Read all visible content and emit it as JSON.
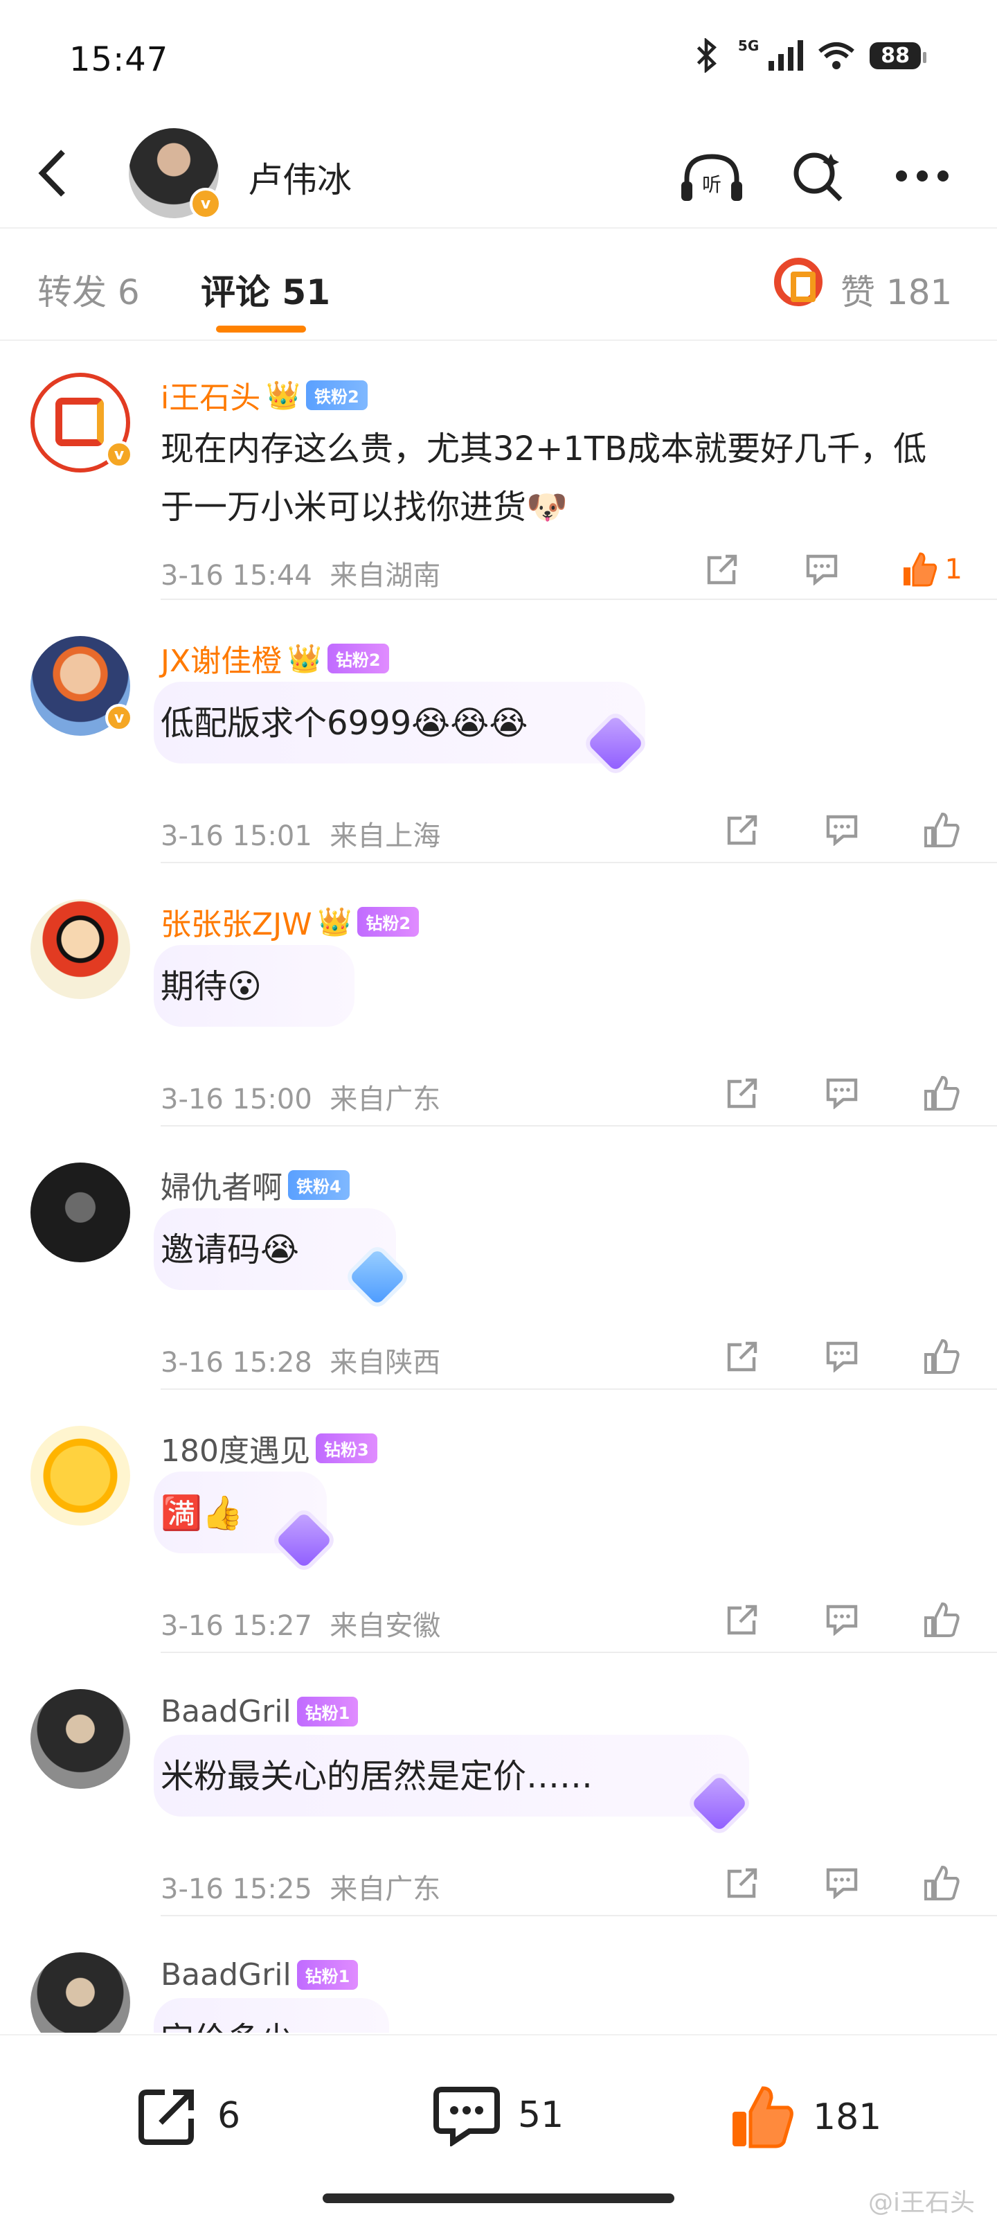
{
  "status_bar": {
    "time": "15:47",
    "network": "5G",
    "battery": "88"
  },
  "header": {
    "user_name": "卢伟冰"
  },
  "tabs": [
    {
      "label": "转发 6"
    },
    {
      "label": "评论 51"
    },
    {
      "label": "赞 181"
    }
  ],
  "comments": [
    {
      "name": "i王石头",
      "badge": "铁粉2",
      "text": "现在内存这么贵，尤其32+1TB成本就要好几千，低于一万小米可以找你进货🐶",
      "time": "3-16 15:44",
      "location": "来自湖南",
      "likes": "1"
    },
    {
      "name": "JX谢佳橙",
      "badge": "钻粉2",
      "text": "低配版求个6999😭😭😭",
      "time": "3-16 15:01",
      "location": "来自上海",
      "likes": ""
    },
    {
      "name": "张张张ZJW",
      "badge": "钻粉2",
      "text": "期待😮",
      "time": "3-16 15:00",
      "location": "来自广东",
      "likes": ""
    },
    {
      "name": "婦仇者啊",
      "badge": "铁粉4",
      "text": "邀请码😭",
      "time": "3-16 15:28",
      "location": "来自陕西",
      "likes": ""
    },
    {
      "name": "180度遇见",
      "badge": "钻粉3",
      "text": "🈵👍",
      "time": "3-16 15:27",
      "location": "来自安徽",
      "likes": ""
    },
    {
      "name": "BaadGril",
      "badge": "钻粉1",
      "text": "米粉最关心的居然是定价……",
      "time": "3-16 15:25",
      "location": "来自广东",
      "likes": ""
    },
    {
      "name": "BaadGril",
      "badge": "钻粉1",
      "text": "定价多少",
      "time": "",
      "location": "",
      "likes": ""
    }
  ],
  "bottom_bar": {
    "repost_count": "6",
    "comment_count": "51",
    "like_count": "181"
  },
  "watermark": "@i王石头",
  "colors": {
    "accent": "#ff8200",
    "like_active": "#ff6a00",
    "vip_name": "#ff7a00",
    "verified": "#f5a623"
  }
}
